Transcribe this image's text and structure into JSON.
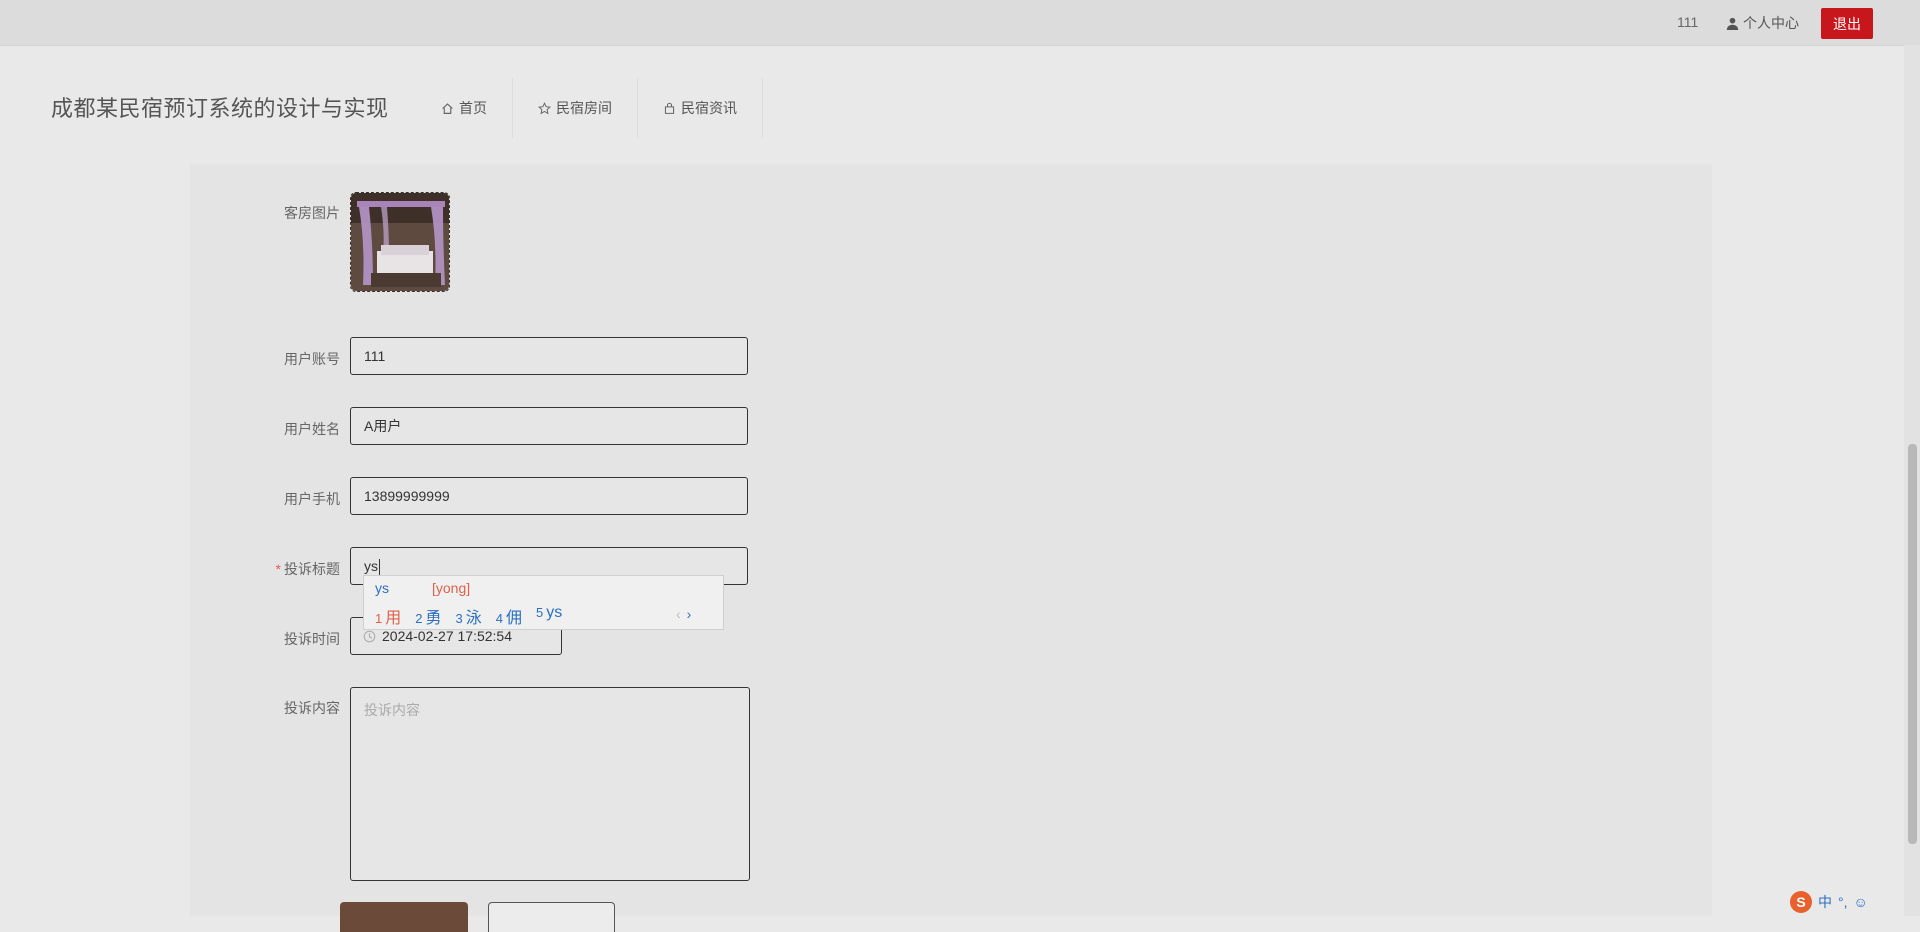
{
  "topbar": {
    "username": "111",
    "personal_center": "个人中心",
    "logout": "退出"
  },
  "header": {
    "site_title": "成都某民宿预订系统的设计与实现",
    "nav": [
      {
        "label": "首页",
        "icon": "home-icon"
      },
      {
        "label": "民宿房间",
        "icon": "star-icon"
      },
      {
        "label": "民宿资讯",
        "icon": "bag-icon"
      }
    ]
  },
  "form": {
    "room_image_label": "客房图片",
    "account_label": "用户账号",
    "account_value": "111",
    "name_label": "用户姓名",
    "name_value": "A用户",
    "phone_label": "用户手机",
    "phone_value": "13899999999",
    "title_required": "*",
    "title_label": "投诉标题",
    "title_value": "ys",
    "time_label": "投诉时间",
    "time_value": "2024-02-27 17:52:54",
    "content_label": "投诉内容",
    "content_placeholder": "投诉内容"
  },
  "ime": {
    "composition": "ys",
    "pinyin_hint": "[yong]",
    "candidates": [
      {
        "num": "1",
        "text": "用"
      },
      {
        "num": "2",
        "text": "勇"
      },
      {
        "num": "3",
        "text": "泳"
      },
      {
        "num": "4",
        "text": "佣"
      },
      {
        "num": "5",
        "text": "ys"
      }
    ],
    "prev": "‹",
    "next": "›"
  },
  "ime_status": {
    "logo": "S",
    "mode": "中",
    "punct": "°,",
    "emoji": "☺"
  },
  "colors": {
    "accent_red": "#c8161d",
    "submit_brown": "#6b4a3a",
    "ime_blue": "#2a6fc2",
    "ime_orange": "#e0604a"
  }
}
